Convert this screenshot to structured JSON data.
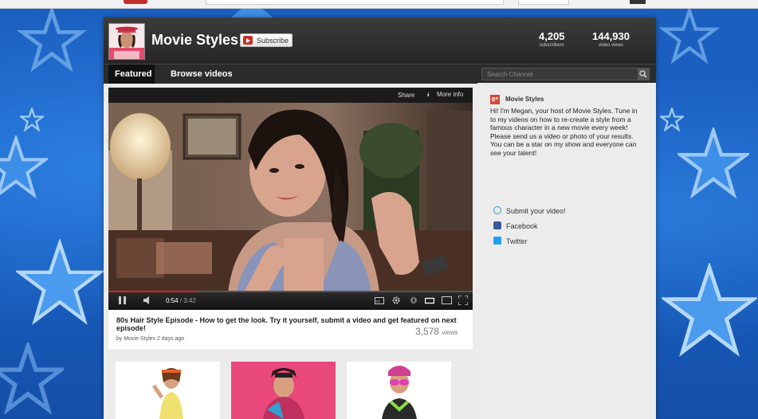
{
  "channel": {
    "title": "Movie Styles",
    "subscribe_label": "Subscribe",
    "stats": [
      {
        "value": "4,205",
        "caption": "subscribers"
      },
      {
        "value": "144,930",
        "caption": "video views"
      }
    ]
  },
  "nav": {
    "tabs": [
      {
        "label": "Featured",
        "active": true
      },
      {
        "label": "Browse videos",
        "active": false
      }
    ],
    "search_placeholder": "Search Channel"
  },
  "player": {
    "share_label": "Share",
    "more_info_label": "More info",
    "current_time": "0:54",
    "duration": "3:42",
    "progress_fraction": 0.243
  },
  "featured_video": {
    "title": "80s Hair Style Episode - How to get the look. Try it yourself, submit a video and get featured on next episode!",
    "meta": "by Movie Styles 2 days ago",
    "views_count": "3,578",
    "views_word": "views"
  },
  "sidebar": {
    "name": "Movie Styles",
    "description": "Hi! I'm Megan, your host of Movie Styles. Tune in to my videos on how to re-create a style from a famous character in a new movie every week! Please send us a video or photo of your results. You can be a star on my show and everyone can see your talent!",
    "links": [
      {
        "label": "Submit your video!",
        "icon": "submit-video-icon",
        "color": "#3a9ad9"
      },
      {
        "label": "Facebook",
        "icon": "facebook-icon",
        "color": "#3b5998"
      },
      {
        "label": "Twitter",
        "icon": "twitter-icon",
        "color": "#1da1f2"
      }
    ]
  },
  "colors": {
    "background": "#1a5fc0",
    "youtube_red": "#c4302b",
    "header_dark": "#2b2b2b"
  }
}
